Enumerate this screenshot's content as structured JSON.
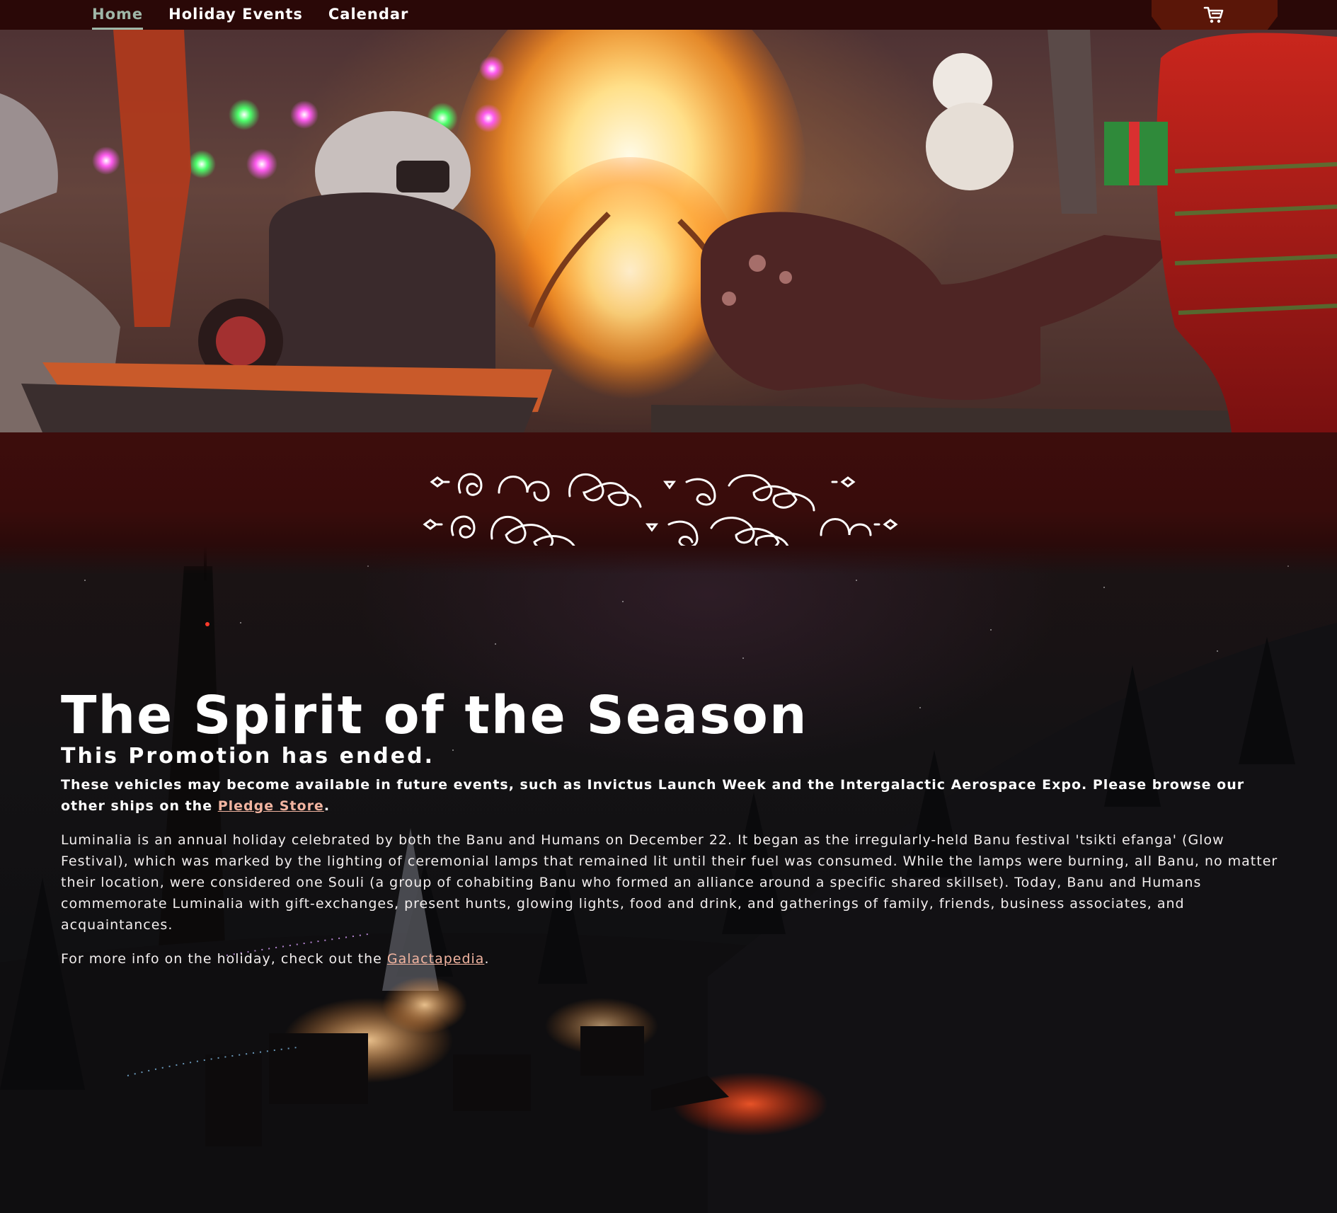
{
  "nav": {
    "items": [
      {
        "label": "Home",
        "active": true
      },
      {
        "label": "Holiday Events",
        "active": false
      },
      {
        "label": "Calendar",
        "active": false
      }
    ],
    "cart_icon": "shopping-cart-icon"
  },
  "hero": {
    "image": "holiday-campfire-with-plush-toys"
  },
  "banu_title": {
    "icon": "banu-glyph-script",
    "lines": 2
  },
  "main": {
    "title": "The Spirit of the Season",
    "subtitle": "This Promotion has ended.",
    "notice_text": "These vehicles may become available in future events, such as Invictus Launch Week and the Intergalactic Aerospace Expo. Please browse our other ships on the ",
    "notice_link": "Pledge Store",
    "notice_end": ".",
    "description": "Luminalia is an annual holiday celebrated by both the Banu and Humans on December 22. It began as the irregularly-held Banu festival 'tsikti efanga' (Glow Festival), which was marked by the lighting of ceremonial lamps that remained lit until their fuel was consumed. While the lamps were burning, all Banu, no matter their location, were considered one Souli (a group of cohabiting Banu who formed an alliance around a specific shared skillset). Today, Banu and Humans commemorate Luminalia with gift-exchanges, present hunts, glowing lights, food and drink, and gatherings of family, friends, business associates, and acquaintances.",
    "more_info_text": "For more info on the holiday, check out the ",
    "more_info_link": "Galactapedia",
    "more_info_end": "."
  },
  "colors": {
    "nav_bg": "#2a0807",
    "nav_active": "#9fb7a8",
    "cart_tab": "#5a1608",
    "band_bg": "#3d0d0c",
    "link": "#f1b4a0"
  }
}
